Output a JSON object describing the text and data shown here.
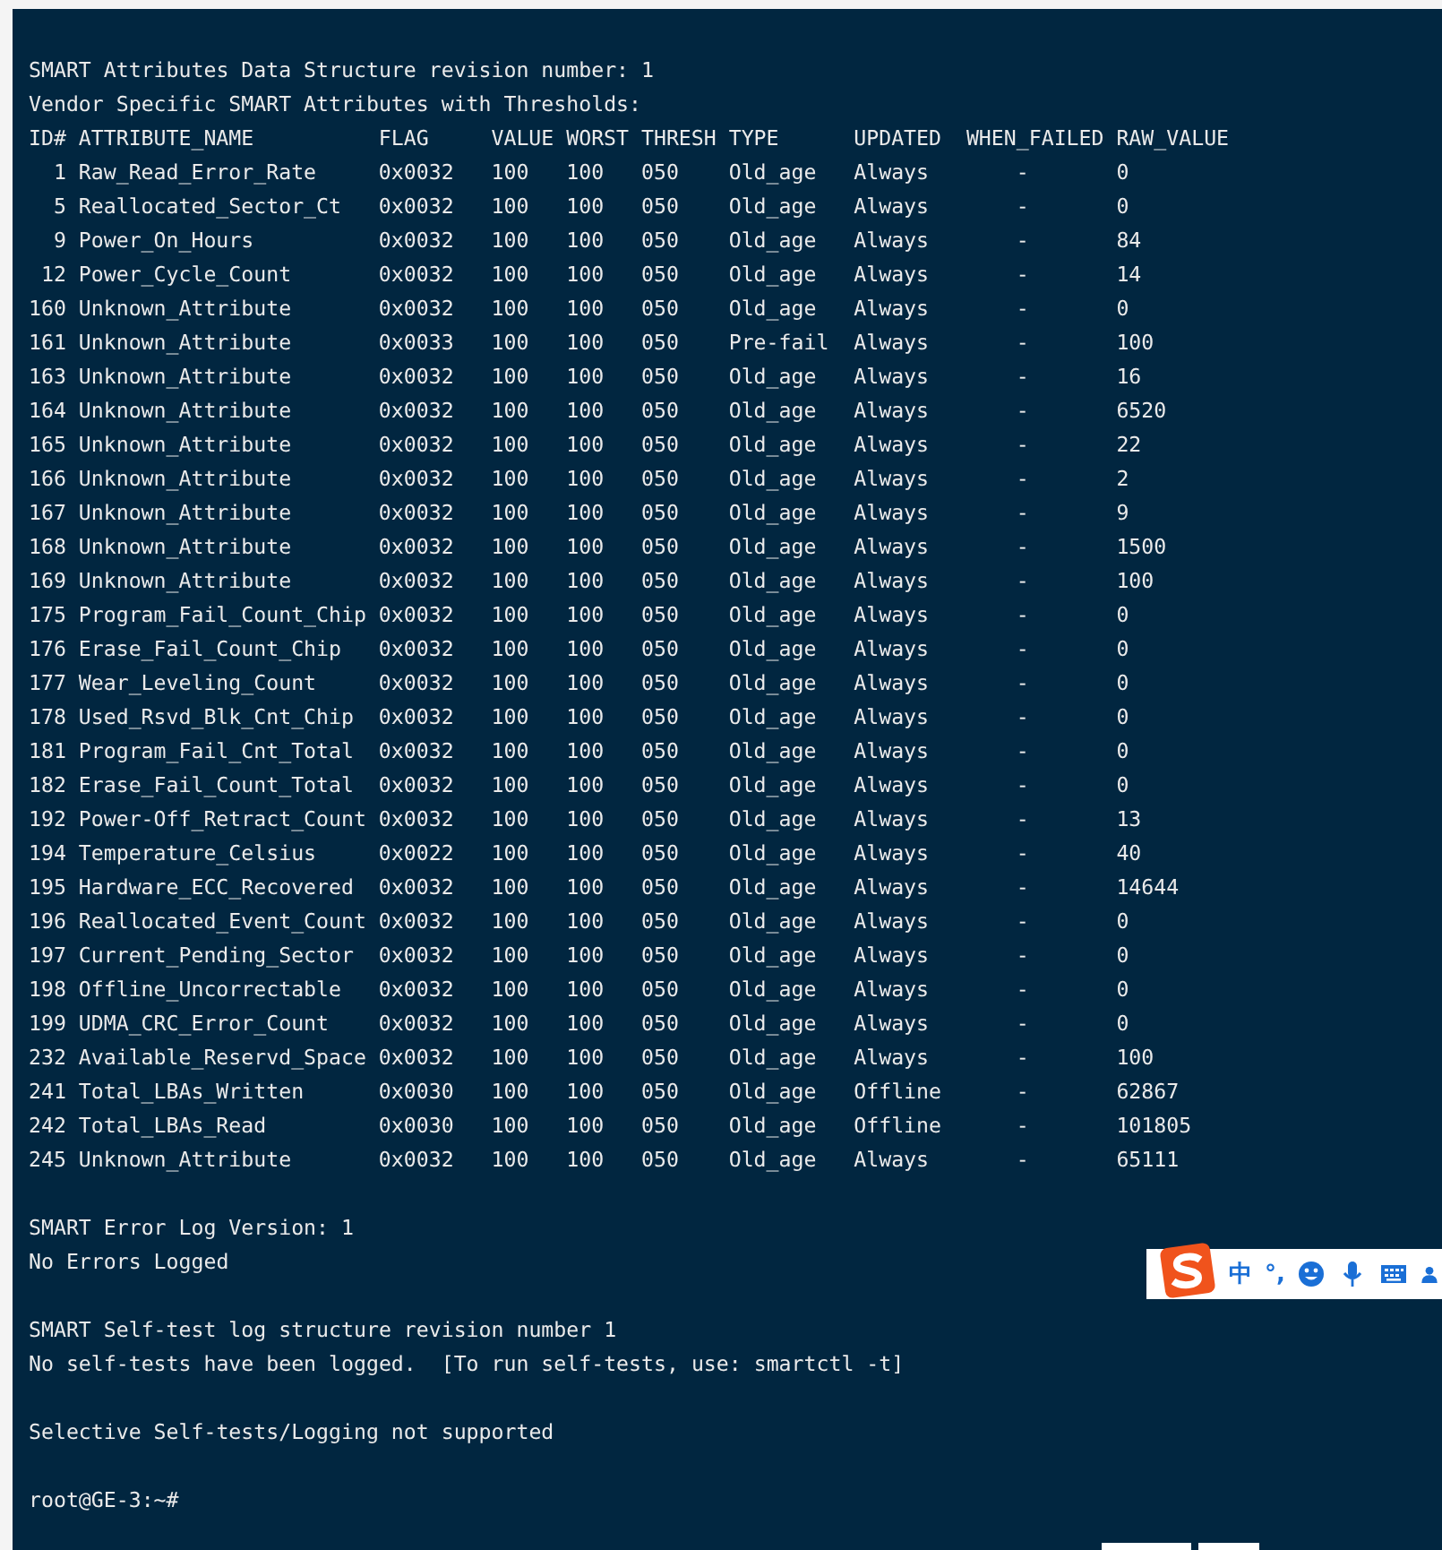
{
  "terminal": {
    "header_lines": [
      "SMART Attributes Data Structure revision number: 1",
      "Vendor Specific SMART Attributes with Thresholds:"
    ],
    "table": {
      "columns": [
        "ID#",
        "ATTRIBUTE_NAME",
        "FLAG",
        "VALUE",
        "WORST",
        "THRESH",
        "TYPE",
        "UPDATED",
        "WHEN_FAILED",
        "RAW_VALUE"
      ],
      "rows": [
        [
          "1",
          "Raw_Read_Error_Rate",
          "0x0032",
          "100",
          "100",
          "050",
          "Old_age",
          "Always",
          "-",
          "0"
        ],
        [
          "5",
          "Reallocated_Sector_Ct",
          "0x0032",
          "100",
          "100",
          "050",
          "Old_age",
          "Always",
          "-",
          "0"
        ],
        [
          "9",
          "Power_On_Hours",
          "0x0032",
          "100",
          "100",
          "050",
          "Old_age",
          "Always",
          "-",
          "84"
        ],
        [
          "12",
          "Power_Cycle_Count",
          "0x0032",
          "100",
          "100",
          "050",
          "Old_age",
          "Always",
          "-",
          "14"
        ],
        [
          "160",
          "Unknown_Attribute",
          "0x0032",
          "100",
          "100",
          "050",
          "Old_age",
          "Always",
          "-",
          "0"
        ],
        [
          "161",
          "Unknown_Attribute",
          "0x0033",
          "100",
          "100",
          "050",
          "Pre-fail",
          "Always",
          "-",
          "100"
        ],
        [
          "163",
          "Unknown_Attribute",
          "0x0032",
          "100",
          "100",
          "050",
          "Old_age",
          "Always",
          "-",
          "16"
        ],
        [
          "164",
          "Unknown_Attribute",
          "0x0032",
          "100",
          "100",
          "050",
          "Old_age",
          "Always",
          "-",
          "6520"
        ],
        [
          "165",
          "Unknown_Attribute",
          "0x0032",
          "100",
          "100",
          "050",
          "Old_age",
          "Always",
          "-",
          "22"
        ],
        [
          "166",
          "Unknown_Attribute",
          "0x0032",
          "100",
          "100",
          "050",
          "Old_age",
          "Always",
          "-",
          "2"
        ],
        [
          "167",
          "Unknown_Attribute",
          "0x0032",
          "100",
          "100",
          "050",
          "Old_age",
          "Always",
          "-",
          "9"
        ],
        [
          "168",
          "Unknown_Attribute",
          "0x0032",
          "100",
          "100",
          "050",
          "Old_age",
          "Always",
          "-",
          "1500"
        ],
        [
          "169",
          "Unknown_Attribute",
          "0x0032",
          "100",
          "100",
          "050",
          "Old_age",
          "Always",
          "-",
          "100"
        ],
        [
          "175",
          "Program_Fail_Count_Chip",
          "0x0032",
          "100",
          "100",
          "050",
          "Old_age",
          "Always",
          "-",
          "0"
        ],
        [
          "176",
          "Erase_Fail_Count_Chip",
          "0x0032",
          "100",
          "100",
          "050",
          "Old_age",
          "Always",
          "-",
          "0"
        ],
        [
          "177",
          "Wear_Leveling_Count",
          "0x0032",
          "100",
          "100",
          "050",
          "Old_age",
          "Always",
          "-",
          "0"
        ],
        [
          "178",
          "Used_Rsvd_Blk_Cnt_Chip",
          "0x0032",
          "100",
          "100",
          "050",
          "Old_age",
          "Always",
          "-",
          "0"
        ],
        [
          "181",
          "Program_Fail_Cnt_Total",
          "0x0032",
          "100",
          "100",
          "050",
          "Old_age",
          "Always",
          "-",
          "0"
        ],
        [
          "182",
          "Erase_Fail_Count_Total",
          "0x0032",
          "100",
          "100",
          "050",
          "Old_age",
          "Always",
          "-",
          "0"
        ],
        [
          "192",
          "Power-Off_Retract_Count",
          "0x0032",
          "100",
          "100",
          "050",
          "Old_age",
          "Always",
          "-",
          "13"
        ],
        [
          "194",
          "Temperature_Celsius",
          "0x0022",
          "100",
          "100",
          "050",
          "Old_age",
          "Always",
          "-",
          "40"
        ],
        [
          "195",
          "Hardware_ECC_Recovered",
          "0x0032",
          "100",
          "100",
          "050",
          "Old_age",
          "Always",
          "-",
          "14644"
        ],
        [
          "196",
          "Reallocated_Event_Count",
          "0x0032",
          "100",
          "100",
          "050",
          "Old_age",
          "Always",
          "-",
          "0"
        ],
        [
          "197",
          "Current_Pending_Sector",
          "0x0032",
          "100",
          "100",
          "050",
          "Old_age",
          "Always",
          "-",
          "0"
        ],
        [
          "198",
          "Offline_Uncorrectable",
          "0x0032",
          "100",
          "100",
          "050",
          "Old_age",
          "Always",
          "-",
          "0"
        ],
        [
          "199",
          "UDMA_CRC_Error_Count",
          "0x0032",
          "100",
          "100",
          "050",
          "Old_age",
          "Always",
          "-",
          "0"
        ],
        [
          "232",
          "Available_Reservd_Space",
          "0x0032",
          "100",
          "100",
          "050",
          "Old_age",
          "Always",
          "-",
          "100"
        ],
        [
          "241",
          "Total_LBAs_Written",
          "0x0030",
          "100",
          "100",
          "050",
          "Old_age",
          "Offline",
          "-",
          "62867"
        ],
        [
          "242",
          "Total_LBAs_Read",
          "0x0030",
          "100",
          "100",
          "050",
          "Old_age",
          "Offline",
          "-",
          "101805"
        ],
        [
          "245",
          "Unknown_Attribute",
          "0x0032",
          "100",
          "100",
          "050",
          "Old_age",
          "Always",
          "-",
          "65111"
        ]
      ]
    },
    "blocks": [
      [
        "SMART Error Log Version: 1",
        "No Errors Logged"
      ],
      [
        "SMART Self-test log structure revision number 1",
        "No self-tests have been logged.  [To run self-tests, use: smartctl -t]"
      ],
      [
        "Selective Self-tests/Logging not supported"
      ],
      [
        "root@GE-3:~#"
      ]
    ]
  },
  "ime_toolbar": {
    "items": [
      "中",
      "°,"
    ]
  }
}
